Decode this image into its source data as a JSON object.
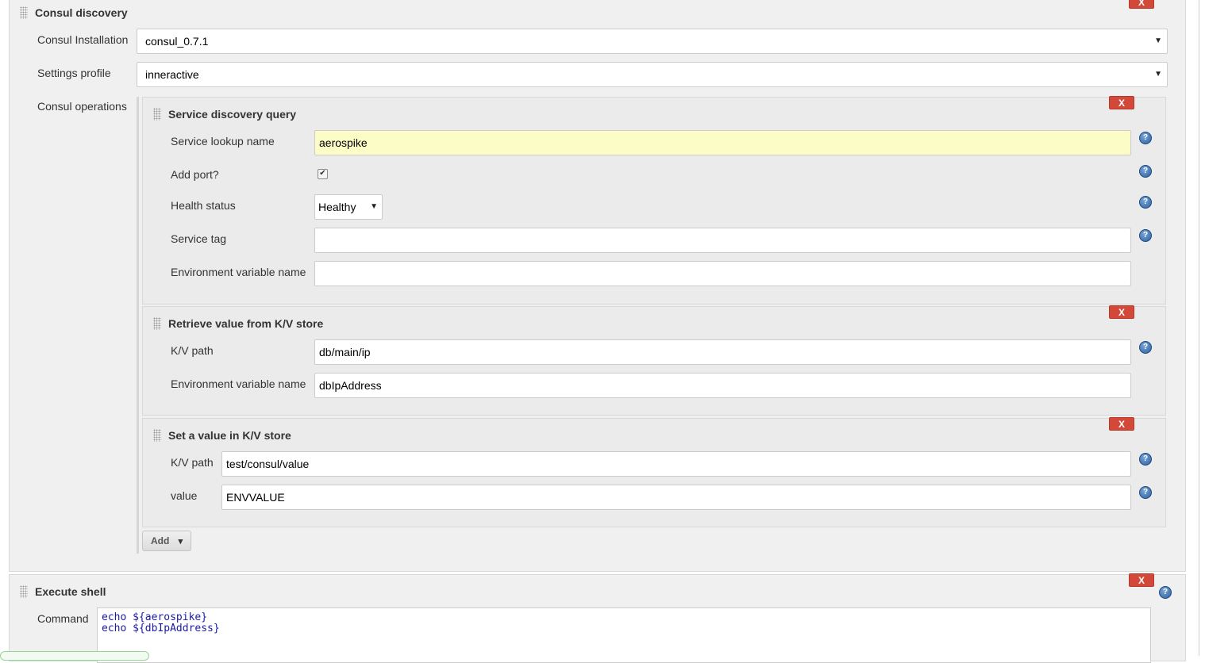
{
  "consul_discovery": {
    "title": "Consul discovery",
    "delete_label": "X",
    "installation_label": "Consul Installation",
    "installation_value": "consul_0.7.1",
    "profile_label": "Settings profile",
    "profile_value": "inneractive",
    "operations_label": "Consul operations",
    "add_label": "Add"
  },
  "service_query": {
    "title": "Service discovery query",
    "delete_label": "X",
    "lookup_label": "Service lookup name",
    "lookup_value": "aerospike",
    "add_port_label": "Add port?",
    "add_port_checked": true,
    "health_label": "Health status",
    "health_value": "Healthy",
    "tag_label": "Service tag",
    "tag_value": "",
    "env_label": "Environment variable name",
    "env_value": ""
  },
  "kv_retrieve": {
    "title": "Retrieve value from K/V store",
    "delete_label": "X",
    "path_label": "K/V path",
    "path_value": "db/main/ip",
    "env_label": "Environment variable name",
    "env_value": "dbIpAddress"
  },
  "kv_set": {
    "title": "Set a value in K/V store",
    "delete_label": "X",
    "path_label": "K/V path",
    "path_value": "test/consul/value",
    "value_label": "value",
    "value_value": "ENVVALUE"
  },
  "execute_shell": {
    "title": "Execute shell",
    "delete_label": "X",
    "command_label": "Command",
    "command_value": "echo ${aerospike}\necho ${dbIpAddress}"
  },
  "icons": {
    "help": "?",
    "dropdown_caret": "▼",
    "add_caret": "▾",
    "check": "✔"
  },
  "colors": {
    "delete_red": "#d24939",
    "highlight_yellow": "#fcfcc6",
    "code_blue": "#1a1aa6"
  }
}
